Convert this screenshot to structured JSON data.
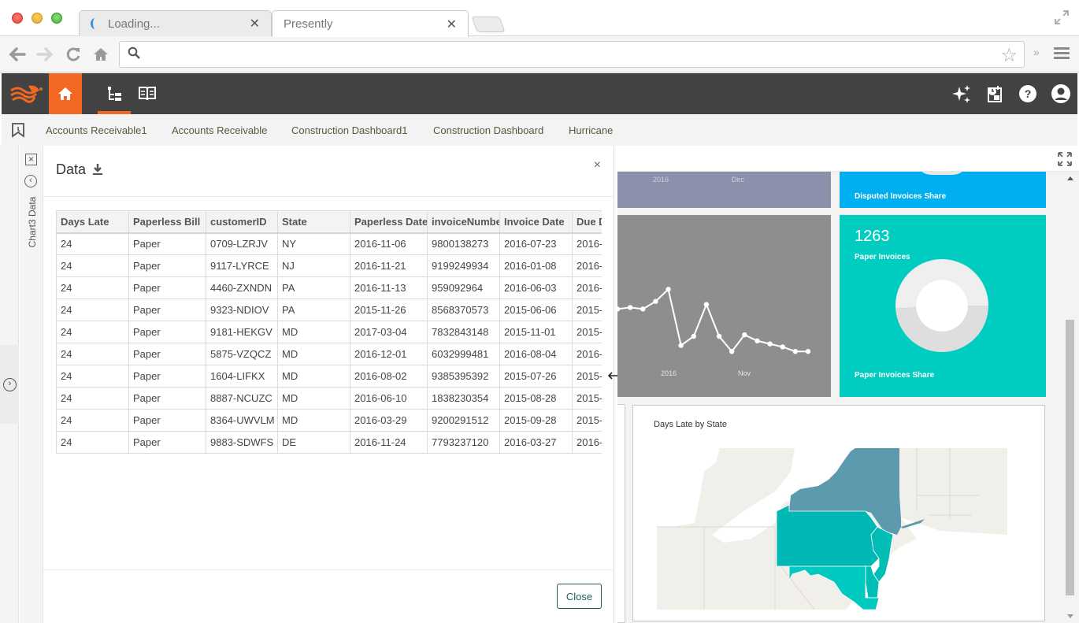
{
  "browser": {
    "tabs": [
      {
        "title": "Loading...",
        "state": "loading"
      },
      {
        "title": "Presently",
        "state": "active"
      }
    ],
    "address": {
      "value": "",
      "placeholder": ""
    },
    "icons": {
      "back": "back-arrow-icon",
      "forward": "forward-arrow-icon",
      "reload": "reload-icon",
      "home": "home-icon",
      "bookmark_star": "star-icon",
      "more": "chevron-double-right-icon",
      "menu": "hamburger-menu-icon"
    }
  },
  "app": {
    "brand_color": "#f26722",
    "header_color": "#424242",
    "nav_icons": [
      "home-icon",
      "hierarchy-icon",
      "book-icon"
    ],
    "right_icons": [
      "sparkle-icon",
      "schedule-report-icon",
      "help-icon",
      "user-account-icon"
    ]
  },
  "bookmarks": {
    "items": [
      {
        "label": "Accounts Receivable1"
      },
      {
        "label": "Accounts Receivable"
      },
      {
        "label": "Construction Dashboard1"
      },
      {
        "label": "Construction Dashboard"
      },
      {
        "label": "Hurricane"
      }
    ]
  },
  "side_strip": {
    "label": "Chart3 Data",
    "close_glyph": "×",
    "back_glyph": "‹",
    "expand_glyph": "›"
  },
  "data_panel": {
    "title": "Data",
    "close_glyph": "×",
    "close_button": "Close",
    "columns": [
      "Days Late",
      "Paperless Bill",
      "customerID",
      "State",
      "Paperless Date",
      "invoiceNumber",
      "Invoice Date",
      "Due Date"
    ],
    "rows": [
      [
        "24",
        "Paper",
        "0709-LZRJV",
        "NY",
        "2016-11-06",
        "9800138273",
        "2016-07-23",
        "2016-"
      ],
      [
        "24",
        "Paper",
        "9117-LYRCE",
        "NJ",
        "2016-11-21",
        "9199249934",
        "2016-01-08",
        "2016-"
      ],
      [
        "24",
        "Paper",
        "4460-ZXNDN",
        "PA",
        "2016-11-13",
        "959092964",
        "2016-06-03",
        "2016-"
      ],
      [
        "24",
        "Paper",
        "9323-NDIOV",
        "PA",
        "2015-11-26",
        "8568370573",
        "2015-06-06",
        "2015-"
      ],
      [
        "24",
        "Paper",
        "9181-HEKGV",
        "MD",
        "2017-03-04",
        "7832843148",
        "2015-11-01",
        "2015-"
      ],
      [
        "24",
        "Paper",
        "5875-VZQCZ",
        "MD",
        "2016-12-01",
        "6032999481",
        "2016-08-04",
        "2016-"
      ],
      [
        "24",
        "Paper",
        "1604-LIFKX",
        "MD",
        "2016-08-02",
        "9385395392",
        "2015-07-26",
        "2015-"
      ],
      [
        "24",
        "Paper",
        "8887-NCUZC",
        "MD",
        "2016-06-10",
        "1838230354",
        "2015-08-28",
        "2015-"
      ],
      [
        "24",
        "Paper",
        "8364-UWVLM",
        "MD",
        "2016-03-29",
        "9200291512",
        "2015-09-28",
        "2015-"
      ],
      [
        "24",
        "Paper",
        "9883-SDWFS",
        "DE",
        "2016-11-24",
        "7793237120",
        "2016-03-27",
        "2016-"
      ]
    ]
  },
  "dashboard": {
    "purple_tile": {
      "axis_labels": [
        "2016",
        "Dec"
      ],
      "color": "#8c90aa"
    },
    "blue_tile": {
      "caption": "Disputed Invoices Share",
      "color": "#00aff0"
    },
    "line_tile": {
      "axis_labels": [
        "2016",
        "Nov"
      ],
      "color": "#8e8e8e",
      "values": [
        58,
        59,
        58,
        63,
        71,
        34,
        40,
        61,
        40,
        30,
        41,
        37,
        35,
        33,
        30,
        30
      ],
      "y_range": [
        0,
        120
      ]
    },
    "teal_tile": {
      "value": "1263",
      "label": "Paper Invoices",
      "caption": "Paper Invoices Share",
      "color": "#00cdc0",
      "share_fraction": 0.51
    },
    "map_tile": {
      "title": "Days Late by State",
      "highlighted_states": [
        {
          "state": "NY",
          "color": "#5e9aad"
        },
        {
          "state": "PA",
          "color": "#00b8b3"
        },
        {
          "state": "NJ",
          "color": "#00bdb5"
        },
        {
          "state": "DE",
          "color": "#00bdb5"
        },
        {
          "state": "MD",
          "color": "#00c9c0"
        }
      ],
      "base_color": "#f1efe9"
    }
  }
}
